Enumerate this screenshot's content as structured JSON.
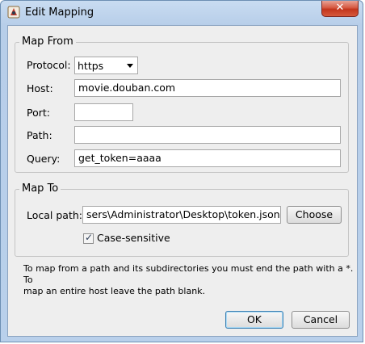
{
  "window": {
    "title": "Edit Mapping",
    "close_label": "✕"
  },
  "map_from": {
    "legend": "Map From",
    "protocol_label": "Protocol:",
    "protocol_value": "https",
    "host_label": "Host:",
    "host_value": "movie.douban.com",
    "port_label": "Port:",
    "port_value": "",
    "path_label": "Path:",
    "path_value": "",
    "query_label": "Query:",
    "query_value": "get_token=aaaa"
  },
  "map_to": {
    "legend": "Map To",
    "local_path_label": "Local path:",
    "local_path_value": "sers\\Administrator\\Desktop\\token.json",
    "choose_label": "Choose",
    "case_sensitive_label": "Case-sensitive",
    "case_sensitive_checked": true
  },
  "help": {
    "line1": "To map from a path and its subdirectories you must end the path with a *. To",
    "line2": "map an entire host leave the path blank."
  },
  "buttons": {
    "ok": "OK",
    "cancel": "Cancel"
  }
}
